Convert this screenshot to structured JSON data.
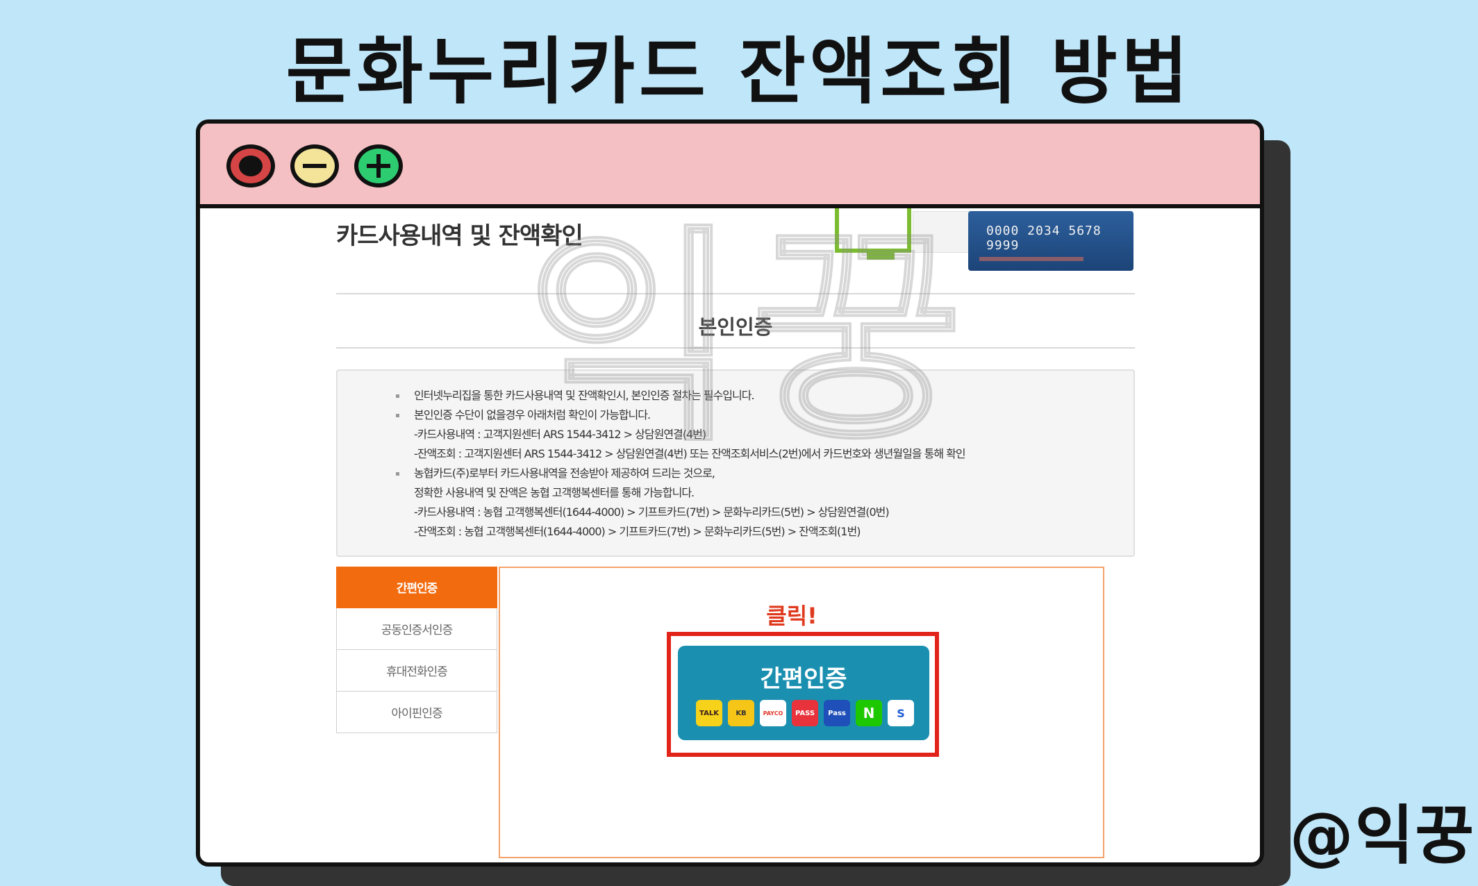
{
  "headline": "문화누리카드 잔액조회 방법",
  "watermark": "익꿍",
  "handle": "@익꿍",
  "page": {
    "section_title": "카드사용내역 및 잔액확인",
    "card_number": "0000 2034 5678 9999",
    "subtitle": "본인인증"
  },
  "notice": {
    "lines": [
      "인터넷누리집을 통한 카드사용내역 및 잔액확인시, 본인인증 절차는 필수입니다.",
      "본인인증 수단이 없을경우 아래처럼 확인이 가능합니다.",
      "-카드사용내역 : 고객지원센터 ARS 1544-3412 > 상담원연결(4번)",
      "-잔액조회 : 고객지원센터 ARS 1544-3412 > 상담원연결(4번) 또는 잔액조회서비스(2번)에서 카드번호와 생년월일을 통해 확인",
      "농협카드(주)로부터 카드사용내역을 전송받아 제공하여 드리는 것으로,",
      "정확한 사용내역 및 잔액은 농협 고객행복센터를 통해 가능합니다.",
      "-카드사용내역 : 농협 고객행복센터(1644-4000) > 기프트카드(7번) > 문화누리카드(5번) > 상담원연결(0번)",
      "-잔액조회 : 농협 고객행복센터(1644-4000) > 기프트카드(7번) > 문화누리카드(5번) > 잔액조회(1번)"
    ]
  },
  "tabs": [
    "간편인증",
    "공동인증서인증",
    "휴대전화인증",
    "아이핀인증"
  ],
  "panel": {
    "click_label": "클릭!",
    "auth_button_label": "간편인증",
    "logos": [
      {
        "text": "TALK",
        "color": "#f7d21a"
      },
      {
        "text": "KB",
        "color": "#f5c518"
      },
      {
        "text": "PAYCO",
        "color": "#ffffff"
      },
      {
        "text": "PASS",
        "color": "#e8333c"
      },
      {
        "text": "Pass",
        "color": "#1f4fb8"
      },
      {
        "text": "N",
        "color": "#1ec800"
      },
      {
        "text": "S",
        "color": "#ffffff"
      }
    ]
  }
}
